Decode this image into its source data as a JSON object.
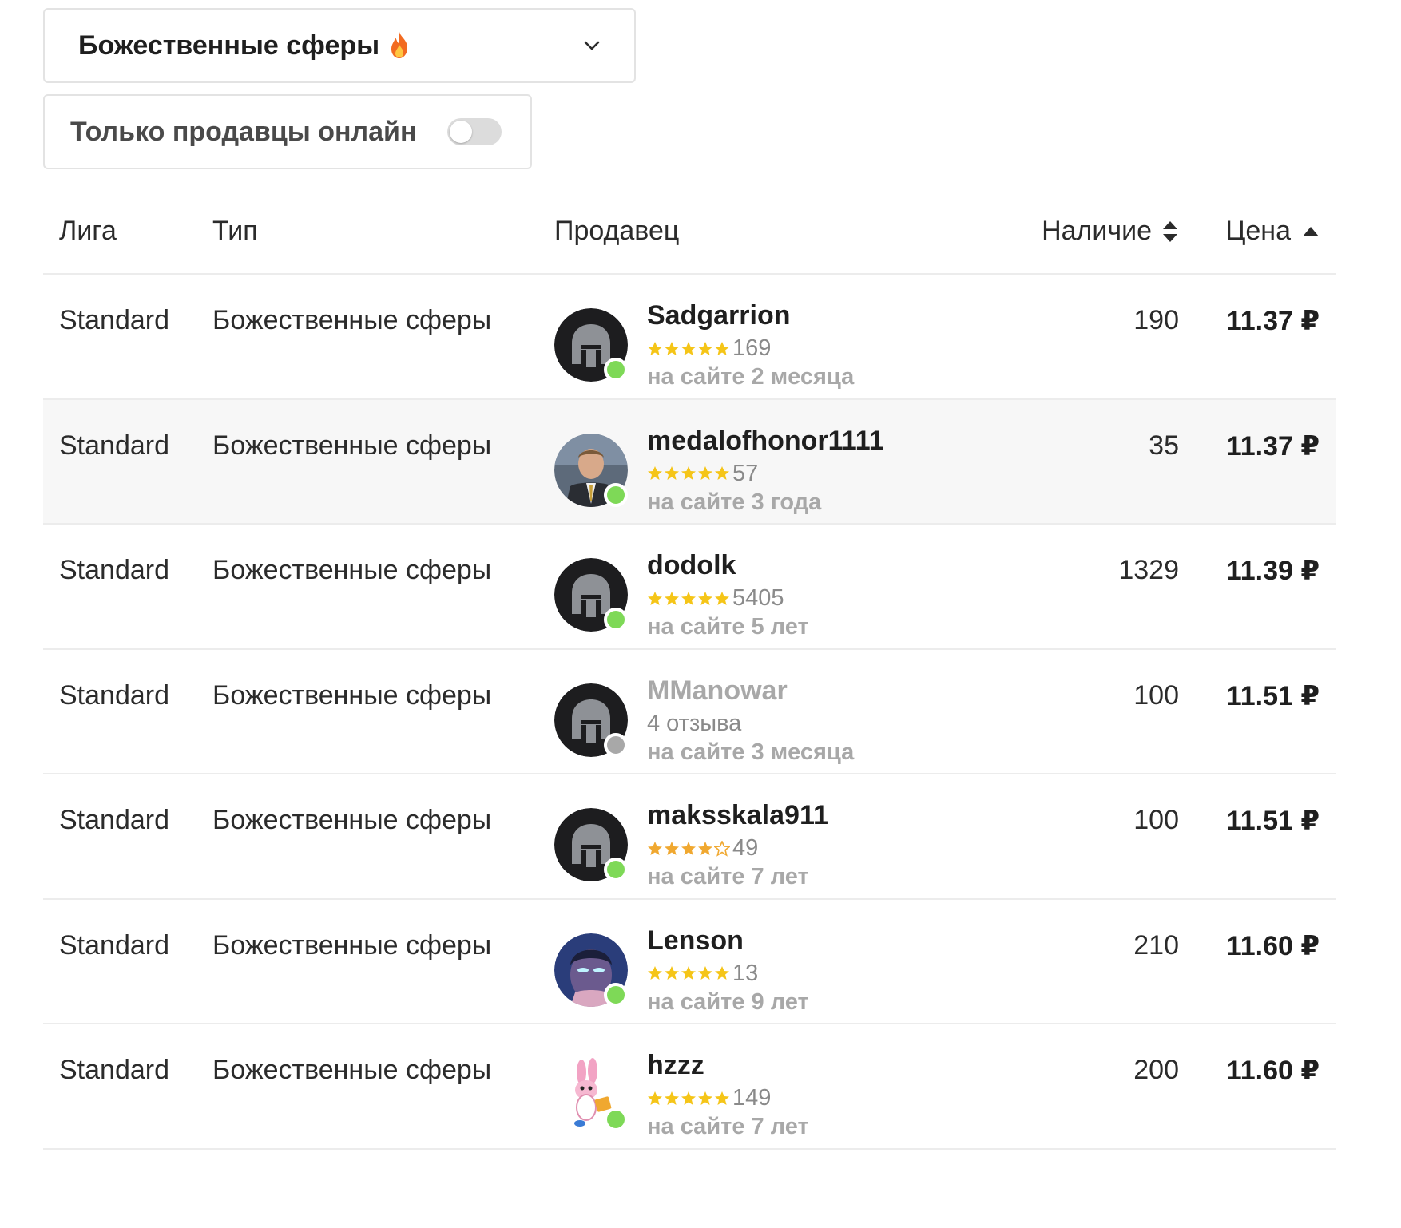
{
  "filter": {
    "selected_type": "Божественные сферы",
    "online_only_label": "Только продавцы онлайн",
    "online_only_enabled": false
  },
  "table": {
    "headers": {
      "league": "Лига",
      "type": "Тип",
      "seller": "Продавец",
      "stock": "Наличие",
      "price": "Цена"
    },
    "sort": {
      "column": "price",
      "direction": "ascending"
    },
    "rows": [
      {
        "league": "Standard",
        "type": "Божественные сферы",
        "seller": "Sadgarrion",
        "avatar": "helmet-avatar",
        "online": true,
        "stars": 5,
        "reviews": "169",
        "member_since": "на сайте 2 месяца",
        "stock": "190",
        "price": "11.37 ₽"
      },
      {
        "league": "Standard",
        "type": "Божественные сферы",
        "seller": "medalofhonor1111",
        "avatar": "photo-avatar-man",
        "online": true,
        "stars": 5,
        "reviews": "57",
        "member_since": "на сайте 3 года",
        "stock": "35",
        "price": "11.37 ₽"
      },
      {
        "league": "Standard",
        "type": "Божественные сферы",
        "seller": "dodolk",
        "avatar": "helmet-avatar",
        "online": true,
        "stars": 5,
        "reviews": "5405",
        "member_since": "на сайте 5 лет",
        "stock": "1329",
        "price": "11.39 ₽"
      },
      {
        "league": "Standard",
        "type": "Божественные сферы",
        "seller": "MManowar",
        "avatar": "helmet-avatar",
        "online": false,
        "stars": 0,
        "reviews": "4 отзыва",
        "member_since": "на сайте 3 месяца",
        "stock": "100",
        "price": "11.51 ₽"
      },
      {
        "league": "Standard",
        "type": "Божественные сферы",
        "seller": "maksskala911",
        "avatar": "helmet-avatar",
        "online": true,
        "stars": 4,
        "reviews": "49",
        "member_since": "на сайте 7 лет",
        "stock": "100",
        "price": "11.51 ₽"
      },
      {
        "league": "Standard",
        "type": "Божественные сферы",
        "seller": "Lenson",
        "avatar": "photo-avatar-glowing-eyes",
        "online": true,
        "stars": 5,
        "reviews": "13",
        "member_since": "на сайте 9 лет",
        "stock": "210",
        "price": "11.60 ₽"
      },
      {
        "league": "Standard",
        "type": "Божественные сферы",
        "seller": "hzzz",
        "avatar": "cartoon-bunny-avatar",
        "online": true,
        "stars": 5,
        "reviews": "149",
        "member_since": "на сайте 7 лет",
        "stock": "200",
        "price": "11.60 ₽"
      }
    ]
  },
  "colors": {
    "online": "#7ed957",
    "offline": "#a8a8a8",
    "star_gold": "#f5c518",
    "star_orange": "#f0a830",
    "border": "#e3e3e3",
    "row_alt": "#f7f7f7"
  },
  "icons": {
    "select_badge": "fire-icon",
    "select_caret": "chevron-down-icon",
    "stock_sort": "sort-both-icon",
    "price_sort": "sort-up-icon",
    "rating": "star-icon"
  }
}
